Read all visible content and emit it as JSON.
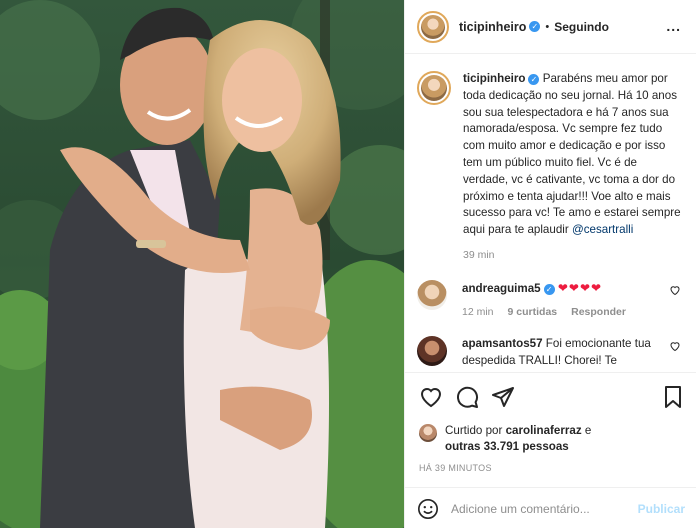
{
  "header": {
    "username": "ticipinheiro",
    "verified_mark": "✓",
    "separator": "•",
    "follow_status": "Seguindo",
    "more_label": "..."
  },
  "caption": {
    "username": "ticipinheiro",
    "text": "Parabéns meu amor por toda dedicação no seu jornal. Há 10 anos sou sua telespectadora e há 7 anos sua namorada/esposa. Vc sempre fez tudo com muito amor e dedicação e por isso tem um público muito fiel. Vc é de verdade, vc é cativante, vc toma a dor do próximo e tenta ajudar!!! Voe alto e mais sucesso para vc! Te amo e estarei sempre aqui para te aplaudir ",
    "mention": "@cesartralli",
    "time": "39 min"
  },
  "comments": [
    {
      "username": "andreaguima5",
      "text": "❤❤❤❤",
      "time": "12 min",
      "likes": "9 curtidas",
      "reply": "Responder"
    },
    {
      "username": "apamsantos57",
      "text": "Foi emocionante tua despedida TRALLI! Chorei! Te"
    }
  ],
  "likes": {
    "prefix": "Curtido por",
    "user": "carolinaferraz",
    "conjunction": "e",
    "others": "outras 33.791 pessoas"
  },
  "posted_ago": "HÁ 39 MINUTOS",
  "comment_box": {
    "placeholder": "Adicione um comentário...",
    "publish": "Publicar"
  },
  "icons": [
    "heart-icon",
    "comment-icon",
    "share-icon",
    "bookmark-icon",
    "emoji-icon",
    "verified-icon",
    "more-icon"
  ],
  "colors": {
    "verified": "#3897f0",
    "link": "#00376b",
    "publish_disabled": "#b2dffc",
    "heart": "#ed1c3f"
  }
}
